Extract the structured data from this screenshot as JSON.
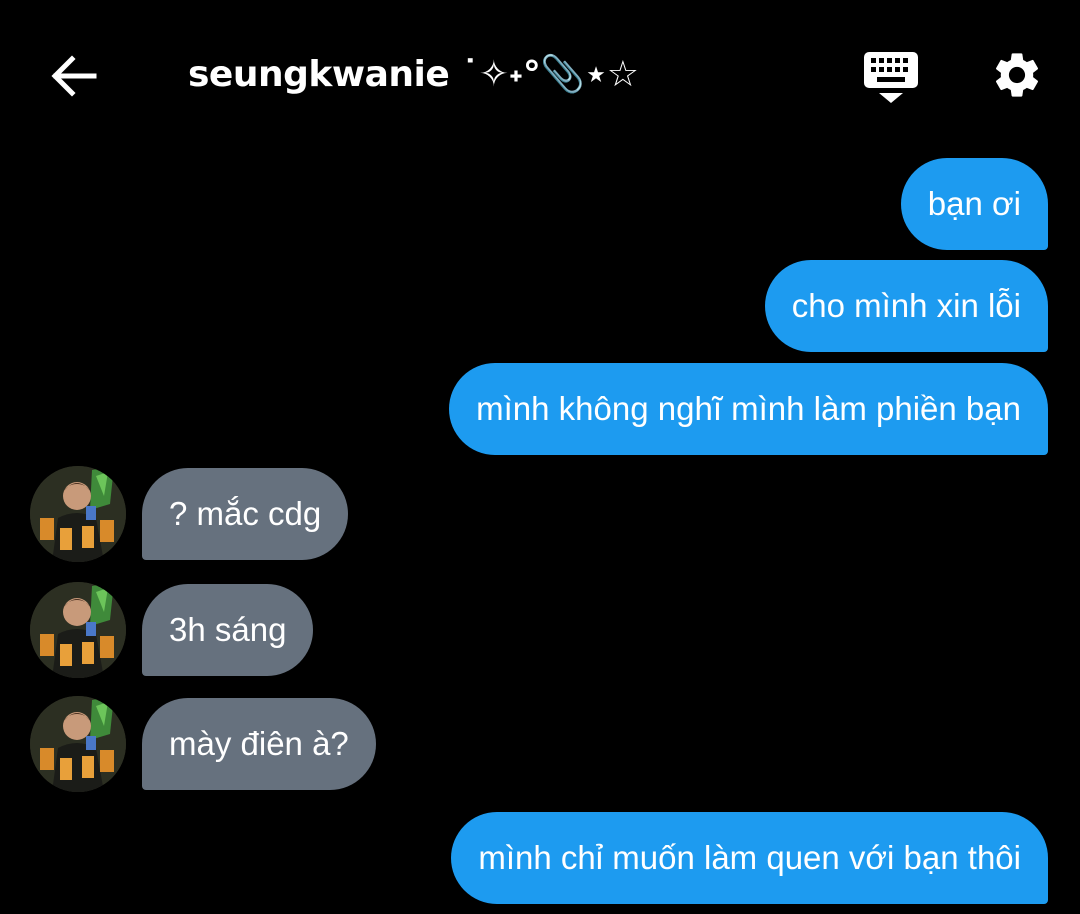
{
  "header": {
    "title": "seungkwanie ˙✧˖°📎⋆☆",
    "back_icon": "arrow-left-icon",
    "keyboard_icon": "keyboard-icon",
    "settings_icon": "gear-icon"
  },
  "messages": [
    {
      "sender": "me",
      "text": "bạn ơi"
    },
    {
      "sender": "me",
      "text": "cho mình xin lỗi"
    },
    {
      "sender": "me",
      "text": "mình không nghĩ mình làm phiền bạn"
    },
    {
      "sender": "them",
      "text": "? mắc cdg"
    },
    {
      "sender": "them",
      "text": "3h sáng"
    },
    {
      "sender": "them",
      "text": "mày điên à?"
    },
    {
      "sender": "me",
      "text": "mình chỉ muốn làm quen với bạn thôi"
    }
  ],
  "colors": {
    "background": "#000000",
    "sent_bubble": "#1d9bf0",
    "received_bubble": "#66717e",
    "text": "#ffffff"
  }
}
